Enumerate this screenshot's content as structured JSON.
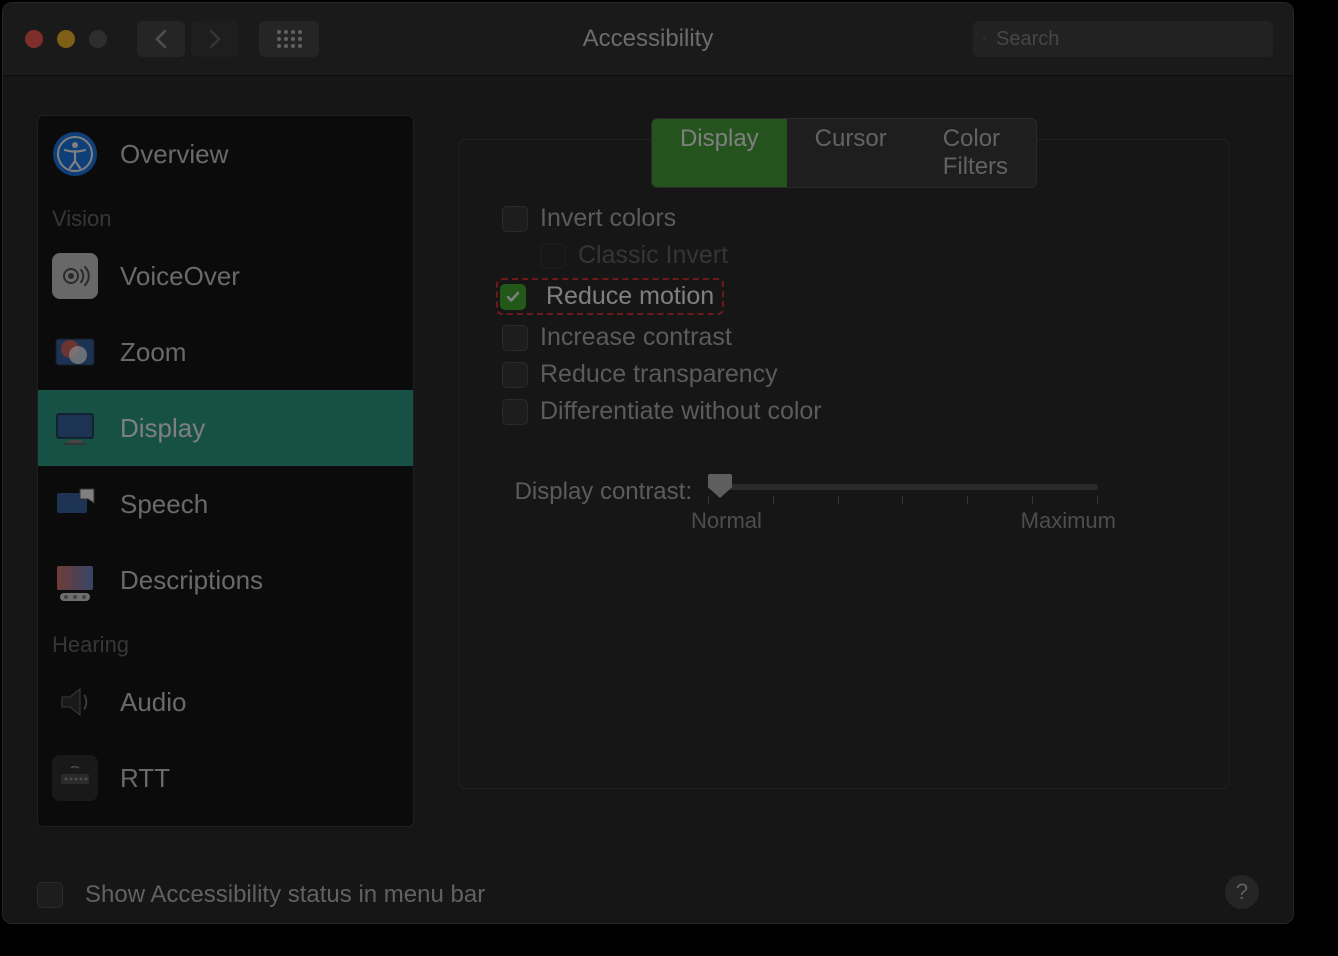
{
  "window": {
    "title": "Accessibility"
  },
  "search": {
    "placeholder": "Search"
  },
  "sidebar": {
    "overview": "Overview",
    "section_vision": "Vision",
    "voiceover": "VoiceOver",
    "zoom": "Zoom",
    "display": "Display",
    "speech": "Speech",
    "descriptions": "Descriptions",
    "section_hearing": "Hearing",
    "audio": "Audio",
    "rtt": "RTT"
  },
  "tabs": {
    "display": "Display",
    "cursor": "Cursor",
    "color_filters": "Color Filters"
  },
  "options": {
    "invert_colors": {
      "label": "Invert colors",
      "checked": false
    },
    "classic_invert": {
      "label": "Classic Invert",
      "checked": false,
      "disabled": true
    },
    "reduce_motion": {
      "label": "Reduce motion",
      "checked": true
    },
    "increase_contrast": {
      "label": "Increase contrast",
      "checked": false
    },
    "reduce_transparency": {
      "label": "Reduce transparency",
      "checked": false
    },
    "differentiate_without_color": {
      "label": "Differentiate without color",
      "checked": false
    }
  },
  "contrast": {
    "label": "Display contrast:",
    "min_label": "Normal",
    "max_label": "Maximum",
    "value": 0,
    "min": 0,
    "max": 100
  },
  "bottom": {
    "show_status_label": "Show Accessibility status in menu bar",
    "show_status_checked": false
  },
  "help": "?"
}
